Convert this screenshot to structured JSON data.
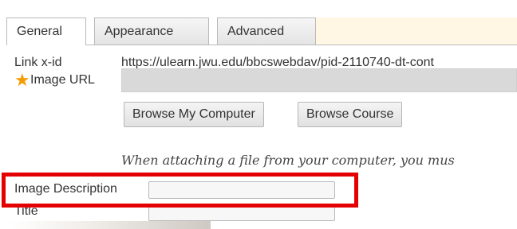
{
  "top_text": "",
  "tabs": [
    {
      "label": "General",
      "active": true
    },
    {
      "label": "Appearance",
      "active": false
    },
    {
      "label": "Advanced",
      "active": false
    }
  ],
  "fields": {
    "link_xid": {
      "label": "Link x-id",
      "value": "https://ulearn.jwu.edu/bbcswebdav/pid-2110740-dt-cont"
    },
    "image_url": {
      "label": "Image URL",
      "required": true,
      "value": ""
    },
    "image_description": {
      "label": "Image Description",
      "value": ""
    },
    "title": {
      "label": "Title",
      "value": ""
    }
  },
  "buttons": {
    "browse_computer": "Browse My Computer",
    "browse_course": "Browse Course"
  },
  "hint_text": "When attaching a file from your computer, you mus",
  "colors": {
    "required_star": "#f59b00",
    "highlight_box": "#e40000",
    "tab_filler": "#fff7e4",
    "url_input_bg": "#d9d9d9"
  }
}
